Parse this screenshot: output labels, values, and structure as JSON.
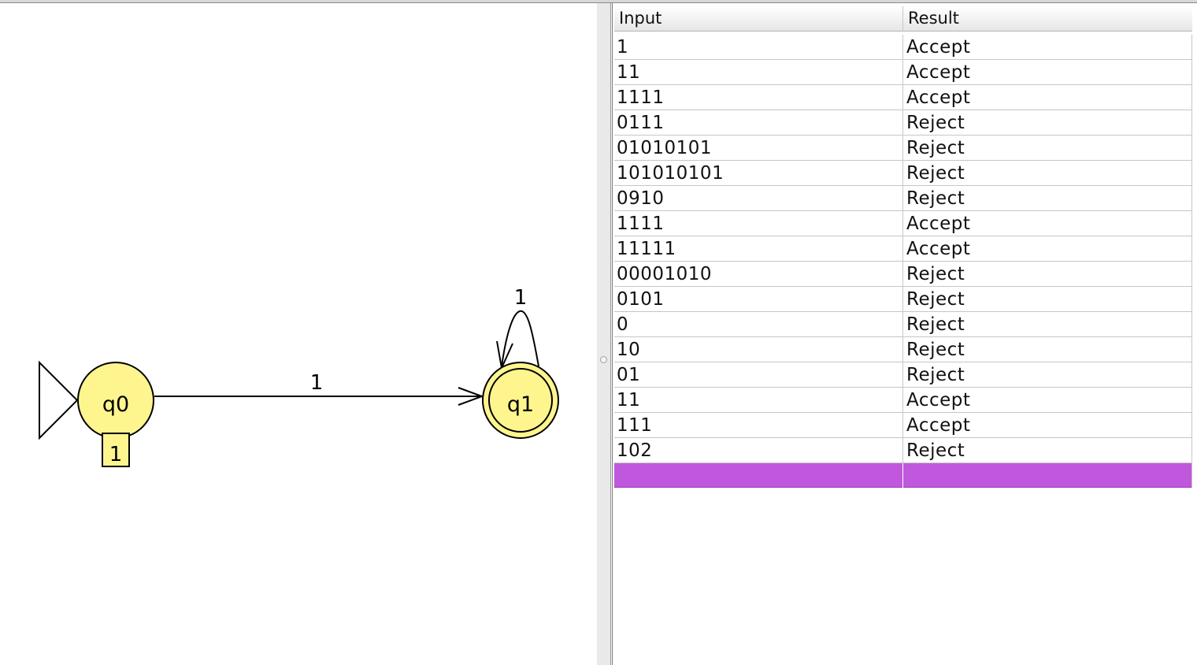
{
  "automaton": {
    "states": [
      {
        "label": "q0",
        "initial": true,
        "final": false,
        "note": "1"
      },
      {
        "label": "q1",
        "initial": false,
        "final": true
      }
    ],
    "transitions": [
      {
        "from": "q0",
        "to": "q1",
        "label": "1"
      },
      {
        "from": "q1",
        "to": "q1",
        "label": "1"
      }
    ],
    "state_color": "#fef58e"
  },
  "table": {
    "columns": [
      "Input",
      "Result"
    ],
    "rows": [
      {
        "input": "1",
        "result": "Accept"
      },
      {
        "input": "11",
        "result": "Accept"
      },
      {
        "input": "1111",
        "result": "Accept"
      },
      {
        "input": "0111",
        "result": "Reject"
      },
      {
        "input": "01010101",
        "result": "Reject"
      },
      {
        "input": "101010101",
        "result": "Reject"
      },
      {
        "input": "0910",
        "result": "Reject"
      },
      {
        "input": "1111",
        "result": "Accept"
      },
      {
        "input": "11111",
        "result": "Accept"
      },
      {
        "input": "00001010",
        "result": "Reject"
      },
      {
        "input": "0101",
        "result": "Reject"
      },
      {
        "input": "0",
        "result": "Reject"
      },
      {
        "input": "10",
        "result": "Reject"
      },
      {
        "input": "01",
        "result": "Reject"
      },
      {
        "input": "11",
        "result": "Accept"
      },
      {
        "input": "111",
        "result": "Accept"
      },
      {
        "input": "102",
        "result": "Reject"
      }
    ],
    "selected_row_color": "#bf58dc"
  }
}
